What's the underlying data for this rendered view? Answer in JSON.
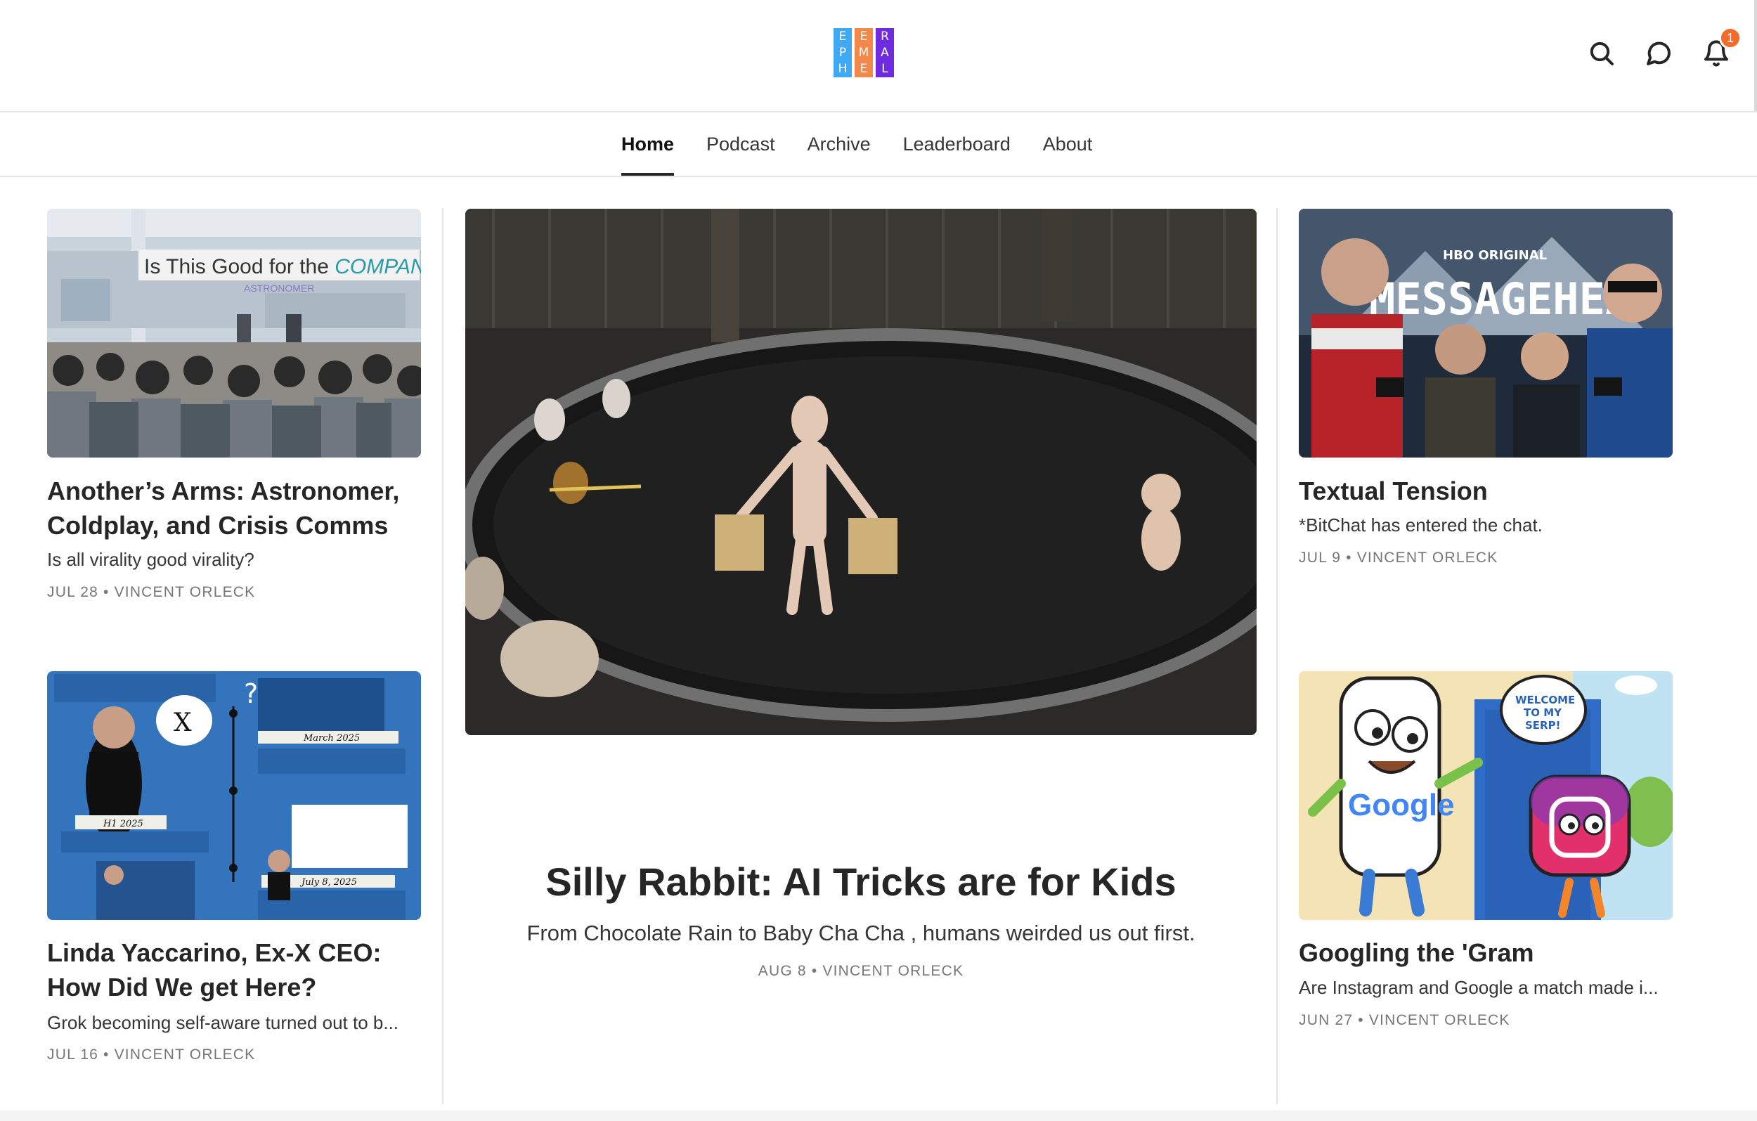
{
  "header": {
    "logo_letters": [
      [
        "E",
        "P",
        "H"
      ],
      [
        "E",
        "M",
        "E"
      ],
      [
        "R",
        "A",
        "L"
      ]
    ],
    "logo_colors": [
      "#3fa9f5",
      "#f4884a",
      "#6f2be0"
    ],
    "icons": [
      "search-icon",
      "chat-icon",
      "bell-icon"
    ],
    "notification_count": "1",
    "badge_color": "#f26b2a"
  },
  "nav": {
    "items": [
      {
        "label": "Home",
        "active": true
      },
      {
        "label": "Podcast",
        "active": false
      },
      {
        "label": "Archive",
        "active": false
      },
      {
        "label": "Leaderboard",
        "active": false
      },
      {
        "label": "About",
        "active": false
      }
    ]
  },
  "posts": {
    "left_top": {
      "title": "Another’s Arms: Astronomer, Coldplay, and Crisis Comms",
      "title_line1": "Another’s Arms: Astronomer,",
      "title_line2": "Coldplay, and Crisis Comms",
      "subtitle": "Is all virality good virality?",
      "meta": "JUL 28 • VINCENT ORLECK",
      "image_text": "Is This Good for the COMPANY",
      "image_text_main": "Is This Good for the ",
      "image_text_accent": "COMPANY",
      "image_subtext": "ASTRONOMER"
    },
    "left_bottom": {
      "title_line1": "Linda Yaccarino, Ex-X CEO:",
      "title_line2": "How Did We get Here?",
      "subtitle": "Grok becoming self-aware turned out to b...",
      "meta": "JUL 16 • VINCENT ORLECK",
      "image_labels": [
        "H1 2025",
        "March 2025",
        "July 8, 2025"
      ]
    },
    "hero": {
      "title": "Silly Rabbit: AI Tricks are for Kids",
      "subtitle": "From Chocolate Rain to Baby Cha Cha , humans weirded us out first.",
      "meta": "AUG 8 • VINCENT ORLECK"
    },
    "right_top": {
      "title": "Textual Tension",
      "subtitle": "*BitChat has entered the chat.",
      "meta": "JUL 9 • VINCENT ORLECK",
      "image_badge": "HBO ORIGINAL",
      "image_title": "MESSAGEHEAD"
    },
    "right_bottom": {
      "title": "Googling the 'Gram",
      "subtitle": "Are Instagram and Google a match made i...",
      "meta": "JUN 27 • VINCENT ORLECK",
      "image_bubble_lines": [
        "WELCOME",
        "TO MY",
        "SERP!"
      ],
      "image_phone_text": "Google"
    }
  }
}
